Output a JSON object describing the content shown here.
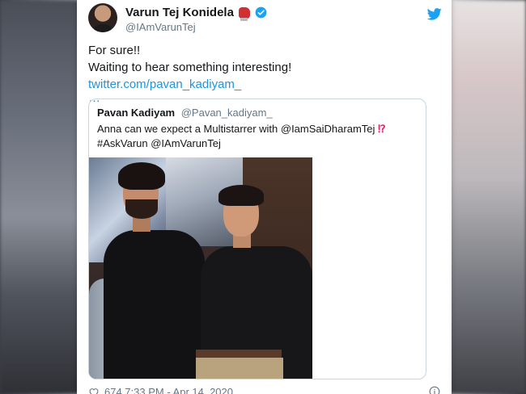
{
  "tweet": {
    "author_name": "Varun Tej Konidela",
    "author_handle": "@IAmVarunTej",
    "line1": "For sure!!",
    "line2": "Waiting to hear something interesting!",
    "link_text": "twitter.com/pavan_kadiyam_",
    "ellipsis": "…",
    "icons": [
      "boxing-glove-icon",
      "verified-badge-icon",
      "twitter-bird-icon"
    ]
  },
  "quote": {
    "author_name": "Pavan Kadiyam",
    "author_handle": "@Pavan_kadiyam_",
    "text_line1": "Anna can we expect a Multistarrer with @IamSaiDharamTej",
    "exclaim": "⁉",
    "text_line2": "#AskVarun @IAmVarunTej"
  },
  "footer": {
    "likes_and_time": "674   7:33 PM - Apr 14, 2020"
  },
  "colors": {
    "link": "#1b95e0",
    "text": "#14171a",
    "muted": "#657786",
    "border": "#ccd6dd",
    "verified": "#1da1f2"
  }
}
